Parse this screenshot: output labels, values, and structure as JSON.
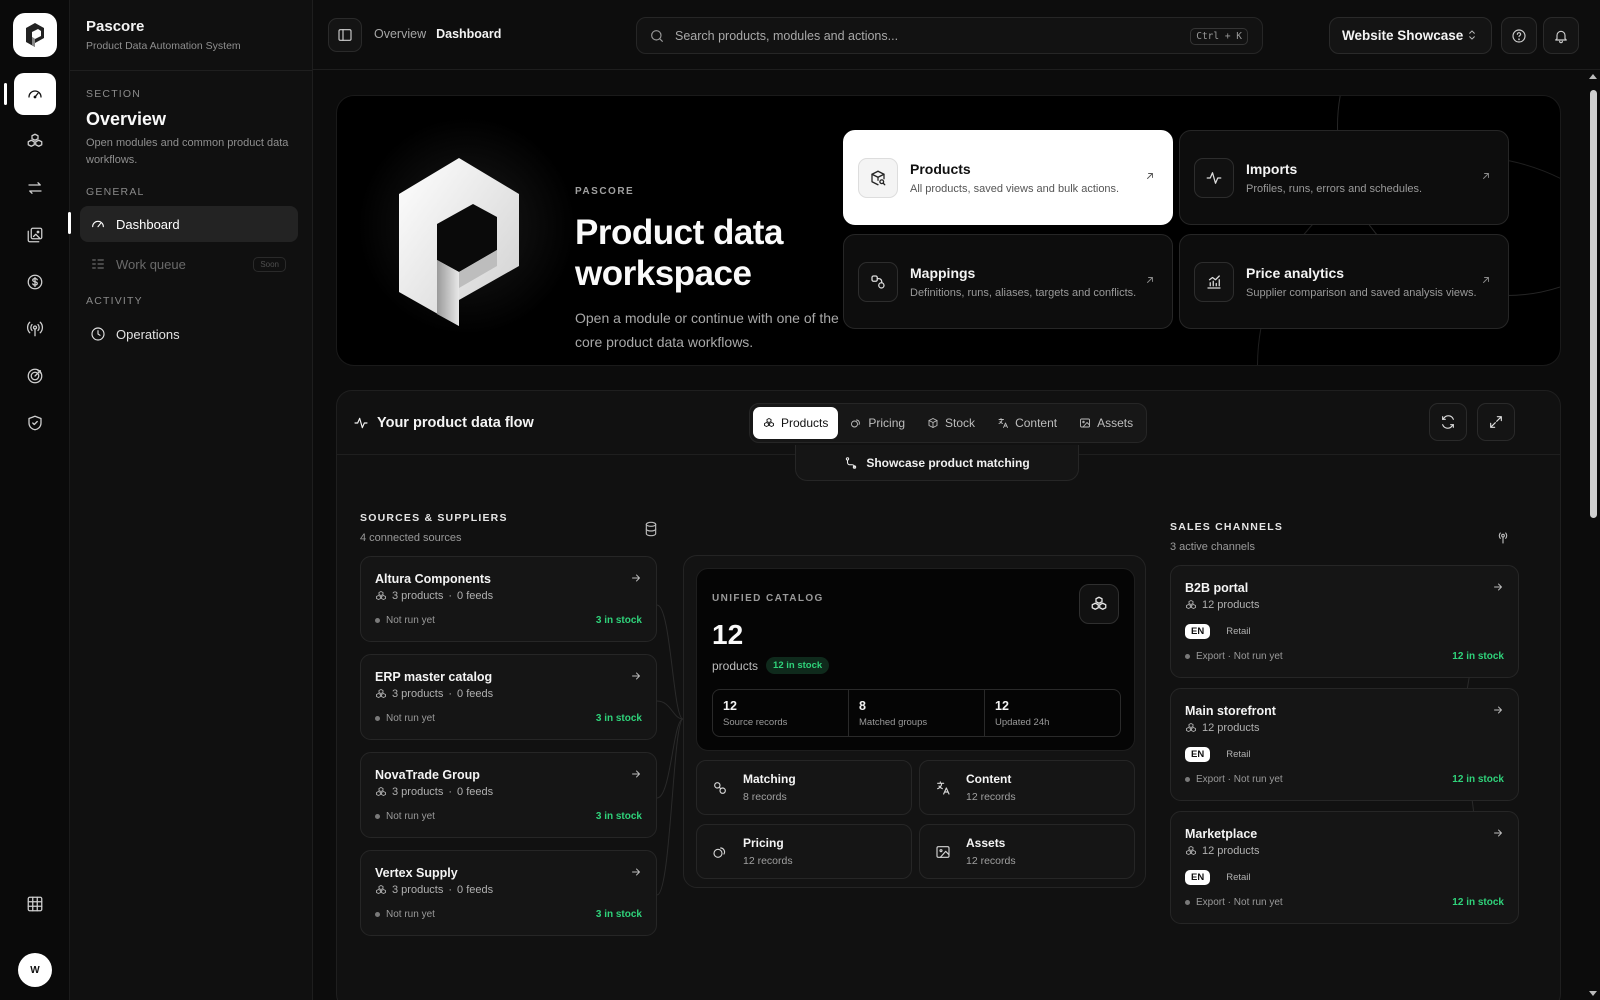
{
  "app": {
    "name": "Pascore",
    "tagline": "Product Data Automation System",
    "user_initial": "W"
  },
  "sidebar": {
    "section_caption": "SECTION",
    "section_title": "Overview",
    "section_desc": "Open modules and common product data workflows.",
    "general_caption": "GENERAL",
    "activity_caption": "ACTIVITY",
    "items": [
      {
        "label": "Dashboard",
        "icon": "gauge-icon",
        "active": true
      },
      {
        "label": "Work queue",
        "icon": "list-check-icon",
        "badge": "Soon"
      },
      {
        "label": "Operations",
        "icon": "clock-icon"
      }
    ]
  },
  "rail": {
    "icons": [
      "gauge-icon",
      "products-icon",
      "transfer-icon",
      "images-icon",
      "dollar-icon",
      "antenna-icon",
      "target-icon",
      "shield-icon",
      "grid-icon"
    ]
  },
  "topbar": {
    "breadcrumb": [
      "Overview",
      "Dashboard"
    ],
    "search_placeholder": "Search products, modules and actions...",
    "shortcut": "Ctrl + K",
    "workspace": "Website Showcase"
  },
  "hero": {
    "eyebrow": "PASCORE",
    "title": "Product data workspace",
    "lead": "Open a module or continue with one of the core product data workflows.",
    "modules": [
      {
        "name": "Products",
        "desc": "All products, saved views and bulk actions.",
        "icon": "box-search-icon"
      },
      {
        "name": "Imports",
        "desc": "Profiles, runs, errors and schedules.",
        "icon": "pulse-icon"
      },
      {
        "name": "Mappings",
        "desc": "Definitions, runs, aliases, targets and conflicts.",
        "icon": "mapping-icon"
      },
      {
        "name": "Price analytics",
        "desc": "Supplier comparison and saved analysis views.",
        "icon": "chart-icon"
      }
    ]
  },
  "flow": {
    "title": "Your product data flow",
    "tabs": [
      "Products",
      "Pricing",
      "Stock",
      "Content",
      "Assets"
    ],
    "subaction": "Showcase product matching",
    "sources": {
      "title": "SOURCES & SUPPLIERS",
      "subtitle": "4 connected sources",
      "items": [
        {
          "name": "Altura Components",
          "products": "3 products",
          "feeds": "0 feeds",
          "status": "Not run yet",
          "stock": "3 in stock"
        },
        {
          "name": "ERP master catalog",
          "products": "3 products",
          "feeds": "0 feeds",
          "status": "Not run yet",
          "stock": "3 in stock"
        },
        {
          "name": "NovaTrade Group",
          "products": "3 products",
          "feeds": "0 feeds",
          "status": "Not run yet",
          "stock": "3 in stock"
        },
        {
          "name": "Vertex Supply",
          "products": "3 products",
          "feeds": "0 feeds",
          "status": "Not run yet",
          "stock": "3 in stock"
        }
      ]
    },
    "catalog": {
      "caption": "UNIFIED CATALOG",
      "count": "12",
      "unit": "products",
      "pill": "12 in stock",
      "stats": [
        {
          "value": "12",
          "label": "Source records"
        },
        {
          "value": "8",
          "label": "Matched groups"
        },
        {
          "value": "12",
          "label": "Updated 24h"
        }
      ],
      "modules": [
        {
          "name": "Matching",
          "records": "8 records",
          "icon": "matching-icon"
        },
        {
          "name": "Content",
          "records": "12 records",
          "icon": "translate-icon"
        },
        {
          "name": "Pricing",
          "records": "12 records",
          "icon": "coins-icon"
        },
        {
          "name": "Assets",
          "records": "12 records",
          "icon": "image-icon"
        }
      ]
    },
    "channels": {
      "title": "SALES CHANNELS",
      "subtitle": "3 active channels",
      "items": [
        {
          "name": "B2B portal",
          "products": "12 products",
          "lang": "EN",
          "type": "Retail",
          "status": "Export · Not run yet",
          "stock": "12 in stock"
        },
        {
          "name": "Main storefront",
          "products": "12 products",
          "lang": "EN",
          "type": "Retail",
          "status": "Export · Not run yet",
          "stock": "12 in stock"
        },
        {
          "name": "Marketplace",
          "products": "12 products",
          "lang": "EN",
          "type": "Retail",
          "status": "Export · Not run yet",
          "stock": "12 in stock"
        }
      ]
    }
  },
  "colors": {
    "accent": "#ffffff",
    "success": "#2fd27a",
    "background": "#0a0a0a"
  }
}
